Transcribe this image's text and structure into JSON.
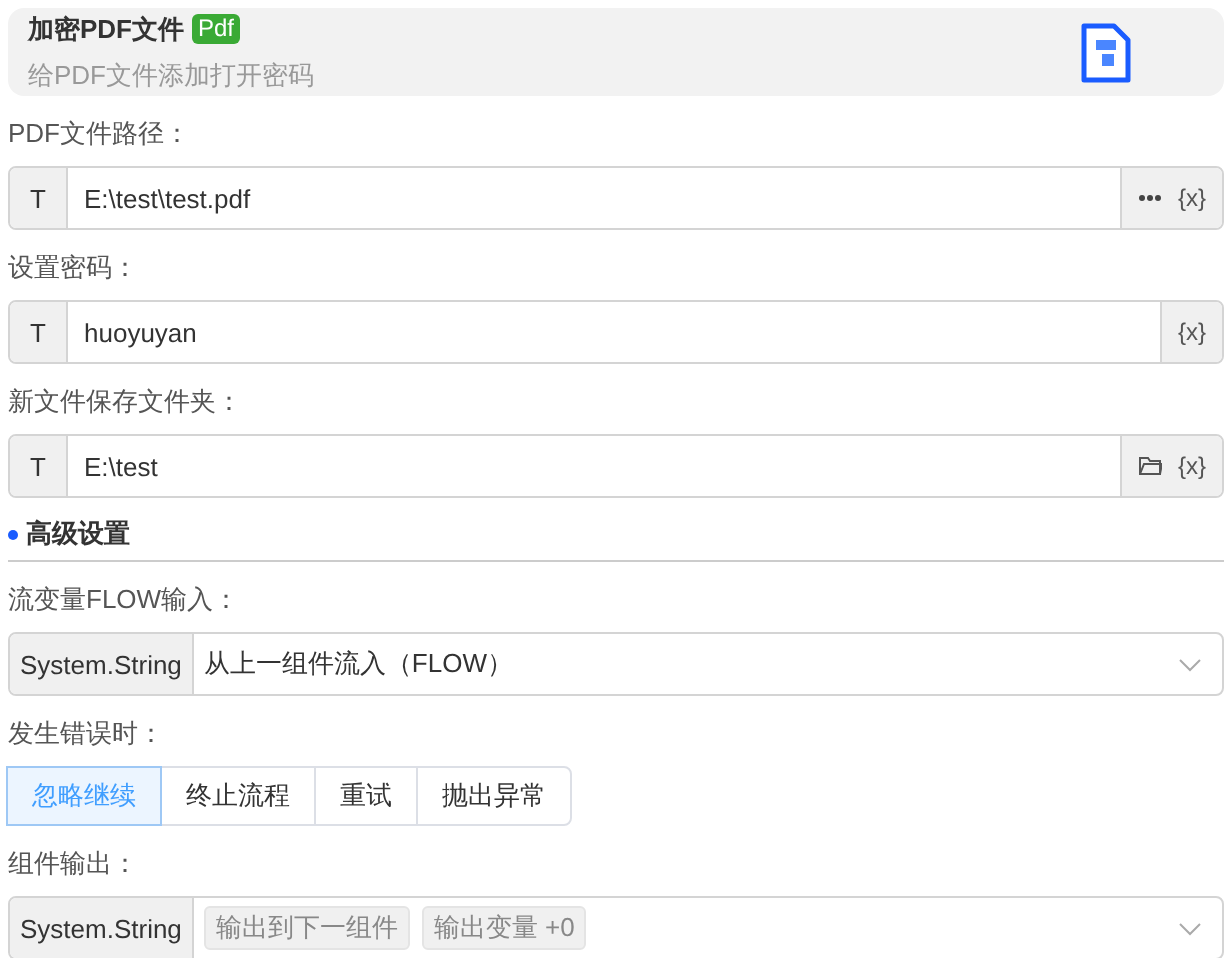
{
  "header": {
    "title": "加密PDF文件",
    "badge": "Pdf",
    "subtitle": "给PDF文件添加打开密码"
  },
  "fields": [
    {
      "label": "PDF文件路径：",
      "prefix": "T",
      "value": "E:\\test\\test.pdf",
      "actions": [
        {
          "kind": "more"
        },
        {
          "kind": "variable",
          "text": "{x}"
        }
      ]
    },
    {
      "label": "设置密码：",
      "prefix": "T",
      "value": "huoyuyan",
      "actions": [
        {
          "kind": "variable",
          "text": "{x}"
        }
      ]
    },
    {
      "label": "新文件保存文件夹：",
      "prefix": "T",
      "value": "E:\\test",
      "actions": [
        {
          "kind": "folder"
        },
        {
          "kind": "variable",
          "text": "{x}"
        }
      ]
    }
  ],
  "section": {
    "title": "高级设置"
  },
  "flow_input": {
    "label": "流变量FLOW输入：",
    "prefix": "System.String",
    "value": "从上一组件流入（FLOW）"
  },
  "on_error": {
    "label": "发生错误时：",
    "options": [
      {
        "label": "忽略继续",
        "selected": true
      },
      {
        "label": "终止流程",
        "selected": false
      },
      {
        "label": "重试",
        "selected": false
      },
      {
        "label": "抛出异常",
        "selected": false
      }
    ]
  },
  "output": {
    "label": "组件输出：",
    "prefix": "System.String",
    "tags": [
      "输出到下一组件",
      "输出变量 +0"
    ]
  }
}
